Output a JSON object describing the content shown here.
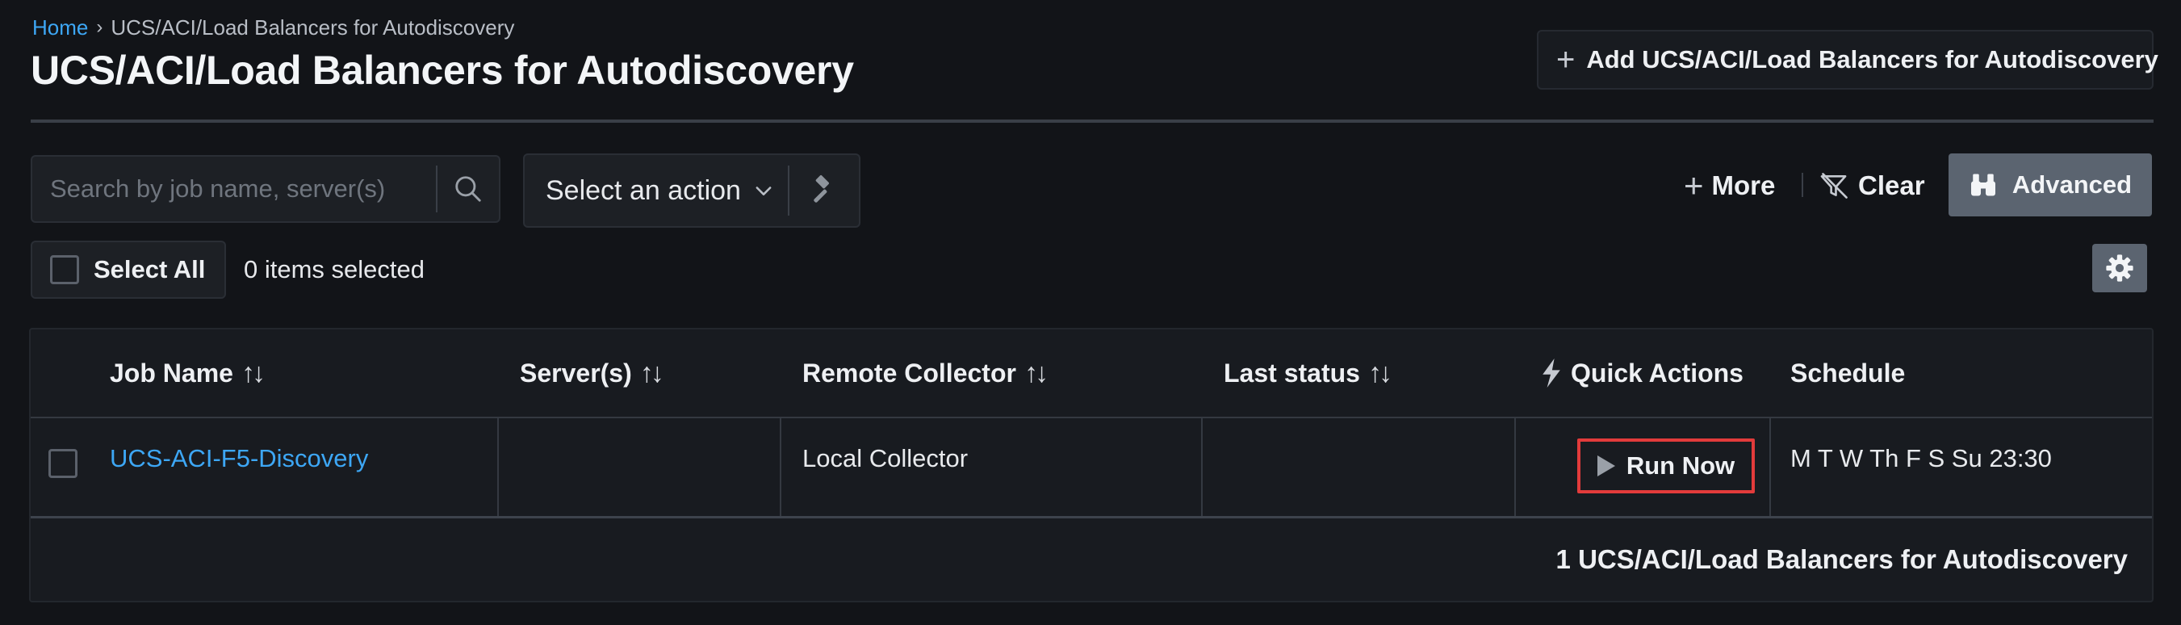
{
  "breadcrumb": {
    "home": "Home",
    "separator": "›",
    "current": "UCS/ACI/Load Balancers for Autodiscovery"
  },
  "page": {
    "title": "UCS/ACI/Load Balancers for Autodiscovery",
    "add_button": "Add UCS/ACI/Load Balancers for Autodiscovery"
  },
  "toolbar": {
    "search_placeholder": "Search by job name, server(s)",
    "action_select": "Select an action",
    "more": "More",
    "clear": "Clear",
    "advanced": "Advanced",
    "select_all": "Select All",
    "items_selected": "0 items selected"
  },
  "table": {
    "columns": {
      "job_name": "Job Name",
      "servers": "Server(s)",
      "remote_collector": "Remote Collector",
      "last_status": "Last status",
      "quick_actions": "Quick Actions",
      "schedule": "Schedule"
    },
    "sort_glyph": "↑↓",
    "rows": [
      {
        "job_name": "UCS-ACI-F5-Discovery",
        "servers": "",
        "remote_collector": "Local Collector",
        "last_status": "",
        "quick_action": "Run Now",
        "schedule": "M T W Th F S Su 23:30"
      }
    ],
    "footer": "1 UCS/ACI/Load Balancers for Autodiscovery"
  },
  "colors": {
    "accent_link": "#3da7f5",
    "highlight_border": "#e23b3b",
    "button_gray": "#5b6470",
    "background": "#121418"
  }
}
